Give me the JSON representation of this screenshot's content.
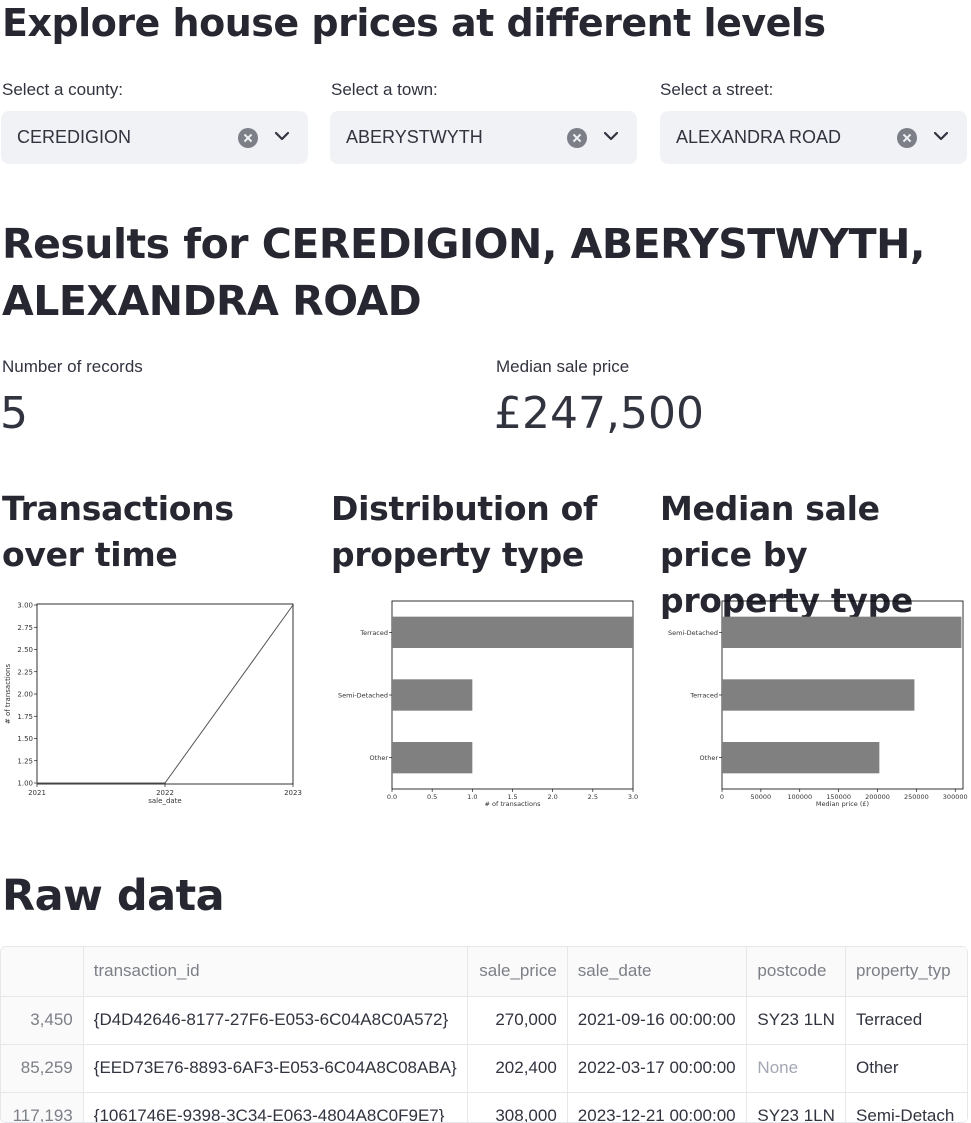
{
  "page_title": "Explore house prices at different levels",
  "filters": [
    {
      "label": "Select a county:",
      "value": "CEREDIGION"
    },
    {
      "label": "Select a town:",
      "value": "ABERYSTWYTH"
    },
    {
      "label": "Select a street:",
      "value": "ALEXANDRA ROAD"
    }
  ],
  "results_heading": "Results for CEREDIGION, ABERYSTWYTH, ALEXANDRA ROAD",
  "metrics": {
    "records": {
      "label": "Number of records",
      "value": "5"
    },
    "median": {
      "label": "Median sale price",
      "value": "£247,500"
    }
  },
  "chart_headings": [
    "Transactions over time",
    "Distribution of property type",
    "Median sale price by property type"
  ],
  "chart_data": [
    {
      "type": "line",
      "x": [
        "2021",
        "2022",
        "2023"
      ],
      "y": [
        1,
        1,
        3
      ],
      "xlabel": "sale_date",
      "ylabel": "# of transactions",
      "ylim": [
        1.0,
        3.0
      ],
      "yticks": [
        "1.00",
        "1.25",
        "1.50",
        "1.75",
        "2.00",
        "2.25",
        "2.50",
        "2.75",
        "3.00"
      ],
      "line_color": "#555555"
    },
    {
      "type": "bar",
      "orientation": "horizontal",
      "categories": [
        "Terraced",
        "Semi-Detached",
        "Other"
      ],
      "values": [
        3,
        1,
        1
      ],
      "xlabel": "# of transactions",
      "xlim": [
        0,
        3.0
      ],
      "xticks": [
        "0.0",
        "0.5",
        "1.0",
        "1.5",
        "2.0",
        "2.5",
        "3.0"
      ],
      "bar_color": "#808080"
    },
    {
      "type": "bar",
      "orientation": "horizontal",
      "categories": [
        "Semi-Detached",
        "Terraced",
        "Other"
      ],
      "values": [
        308000,
        247500,
        202400
      ],
      "xlabel": "Median price (£)",
      "xlim": [
        0,
        310000
      ],
      "xticks": [
        "0",
        "50000",
        "100000",
        "150000",
        "200000",
        "250000",
        "300000"
      ],
      "bar_color": "#808080"
    }
  ],
  "raw_heading": "Raw data",
  "table": {
    "columns": [
      "",
      "transaction_id",
      "sale_price",
      "sale_date",
      "postcode",
      "property_typ"
    ],
    "rows": [
      [
        "3,450",
        "{D4D42646-8177-27F6-E053-6C04A8C0A572}",
        "270,000",
        "2021-09-16 00:00:00",
        "SY23 1LN",
        "Terraced"
      ],
      [
        "85,259",
        "{EED73E76-8893-6AF3-E053-6C04A8C08ABA}",
        "202,400",
        "2022-03-17 00:00:00",
        "None",
        "Other"
      ],
      [
        "117,193",
        "{1061746E-9398-3C34-E063-4804A8C0F9E7}",
        "308,000",
        "2023-12-21 00:00:00",
        "SY23 1LN",
        "Semi-Detach"
      ]
    ]
  },
  "colors": {
    "select_bg": "#f0f2f6",
    "text": "#31333f",
    "muted": "#7c7f87"
  }
}
